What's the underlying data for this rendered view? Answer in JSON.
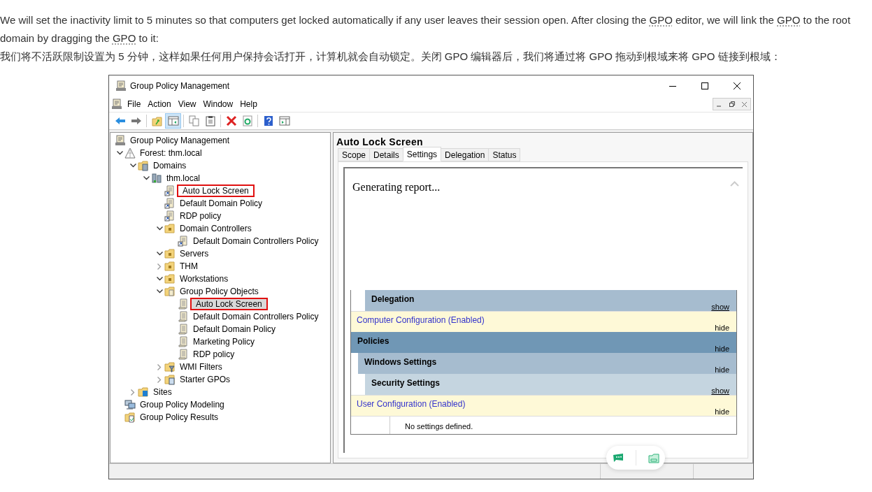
{
  "intro": {
    "english": [
      {
        "text": "We will set the inactivity limit to 5 minutes so that computers get locked automatically if any user leaves their session open. After closing the ",
        "abbreviation": false
      },
      {
        "text": "GPO",
        "abbreviation": true
      },
      {
        "text": " editor, we will link the ",
        "abbreviation": false
      },
      {
        "text": "GPO",
        "abbreviation": true
      },
      {
        "text": " to the root domain by dragging the ",
        "abbreviation": false
      },
      {
        "text": "GPO",
        "abbreviation": true
      },
      {
        "text": " to it:",
        "abbreviation": false
      }
    ],
    "chinese": "我们将不活跃限制设置为 5 分钟，这样如果任何用户保持会话打开，计算机就会自动锁定。关闭 GPO 编辑器后，我们将通过将 GPO 拖动到根域来将 GPO 链接到根域："
  },
  "window": {
    "title": "Group Policy Management",
    "menu": [
      "File",
      "Action",
      "View",
      "Window",
      "Help"
    ],
    "toolbar": [
      {
        "kind": "back",
        "pressed": false
      },
      {
        "kind": "forward",
        "pressed": false
      },
      {
        "kind": "sep"
      },
      {
        "kind": "up",
        "pressed": false
      },
      {
        "kind": "tree",
        "pressed": true
      },
      {
        "kind": "sep"
      },
      {
        "kind": "copy",
        "pressed": false
      },
      {
        "kind": "paste",
        "pressed": false
      },
      {
        "kind": "sep"
      },
      {
        "kind": "delete",
        "pressed": false
      },
      {
        "kind": "refresh",
        "pressed": false
      },
      {
        "kind": "sep"
      },
      {
        "kind": "help",
        "pressed": false
      },
      {
        "kind": "pane",
        "pressed": false
      }
    ],
    "tree": [
      {
        "label": "Group Policy Management",
        "kind": "console",
        "selected": false,
        "highlighted": false,
        "children": [
          {
            "label": "Forest: thm.local",
            "kind": "forest",
            "expanded": true,
            "selected": false,
            "highlighted": false,
            "children": [
              {
                "label": "Domains",
                "kind": "domains",
                "expanded": true,
                "selected": false,
                "highlighted": false,
                "children": [
                  {
                    "label": "thm.local",
                    "kind": "domain",
                    "expanded": true,
                    "selected": false,
                    "highlighted": false,
                    "children": [
                      {
                        "label": "Auto Lock Screen",
                        "kind": "link",
                        "selected": false,
                        "highlighted": true
                      },
                      {
                        "label": "Default Domain Policy",
                        "kind": "link",
                        "selected": false,
                        "highlighted": false
                      },
                      {
                        "label": "RDP policy",
                        "kind": "link",
                        "selected": false,
                        "highlighted": false
                      },
                      {
                        "label": "Domain Controllers",
                        "kind": "ou",
                        "expanded": true,
                        "selected": false,
                        "highlighted": false,
                        "children": [
                          {
                            "label": "Default Domain Controllers Policy",
                            "kind": "link",
                            "selected": false,
                            "highlighted": false
                          }
                        ]
                      },
                      {
                        "label": "Servers",
                        "kind": "ou",
                        "expanded": true,
                        "selected": false,
                        "highlighted": false
                      },
                      {
                        "label": "THM",
                        "kind": "ou",
                        "expanded": false,
                        "selected": false,
                        "highlighted": false
                      },
                      {
                        "label": "Workstations",
                        "kind": "ou",
                        "expanded": true,
                        "selected": false,
                        "highlighted": false
                      },
                      {
                        "label": "Group Policy Objects",
                        "kind": "gpofolder",
                        "expanded": true,
                        "selected": false,
                        "highlighted": false,
                        "children": [
                          {
                            "label": "Auto Lock Screen",
                            "kind": "gpo",
                            "selected": true,
                            "highlighted": true
                          },
                          {
                            "label": "Default Domain Controllers Policy",
                            "kind": "gpo",
                            "selected": false,
                            "highlighted": false
                          },
                          {
                            "label": "Default Domain Policy",
                            "kind": "gpo",
                            "selected": false,
                            "highlighted": false
                          },
                          {
                            "label": "Marketing Policy",
                            "kind": "gpo",
                            "selected": false,
                            "highlighted": false
                          },
                          {
                            "label": "RDP policy",
                            "kind": "gpo",
                            "selected": false,
                            "highlighted": false
                          }
                        ]
                      },
                      {
                        "label": "WMI Filters",
                        "kind": "wmi",
                        "expanded": false,
                        "selected": false,
                        "highlighted": false
                      },
                      {
                        "label": "Starter GPOs",
                        "kind": "starter",
                        "expanded": false,
                        "selected": false,
                        "highlighted": false
                      }
                    ]
                  }
                ]
              },
              {
                "label": "Sites",
                "kind": "sites",
                "expanded": false,
                "selected": false,
                "highlighted": false
              }
            ]
          },
          {
            "label": "Group Policy Modeling",
            "kind": "modeling",
            "selected": false,
            "highlighted": false
          },
          {
            "label": "Group Policy Results",
            "kind": "results",
            "selected": false,
            "highlighted": false
          }
        ]
      }
    ],
    "detail": {
      "title": "Auto Lock Screen",
      "tabs": [
        {
          "label": "Scope",
          "selected": false
        },
        {
          "label": "Details",
          "selected": false
        },
        {
          "label": "Settings",
          "selected": true
        },
        {
          "label": "Delegation",
          "selected": false
        },
        {
          "label": "Status",
          "selected": false
        }
      ],
      "status": "Generating report...",
      "sections": [
        {
          "kind": "category",
          "title": "Delegation",
          "toggle": "show",
          "collapsed": true,
          "color": "#a6bccf"
        },
        {
          "kind": "config",
          "title": "Computer Configuration (Enabled)",
          "toggle": "hide",
          "collapsed": false,
          "children": [
            {
              "kind": "category",
              "title": "Policies",
              "toggle": "hide",
              "collapsed": false,
              "color": "#7097b5",
              "children": [
                {
                  "kind": "category",
                  "title": "Windows Settings",
                  "toggle": "hide",
                  "collapsed": false,
                  "color": "#a6bccf",
                  "children": [
                    {
                      "kind": "category",
                      "title": "Security Settings",
                      "toggle": "show",
                      "collapsed": true,
                      "color": "#c5d5e0"
                    }
                  ]
                }
              ]
            }
          ]
        },
        {
          "kind": "config",
          "title": "User Configuration (Enabled)",
          "toggle": "hide",
          "collapsed": false,
          "children": [
            {
              "kind": "note",
              "title": "No settings defined."
            }
          ]
        }
      ]
    }
  }
}
